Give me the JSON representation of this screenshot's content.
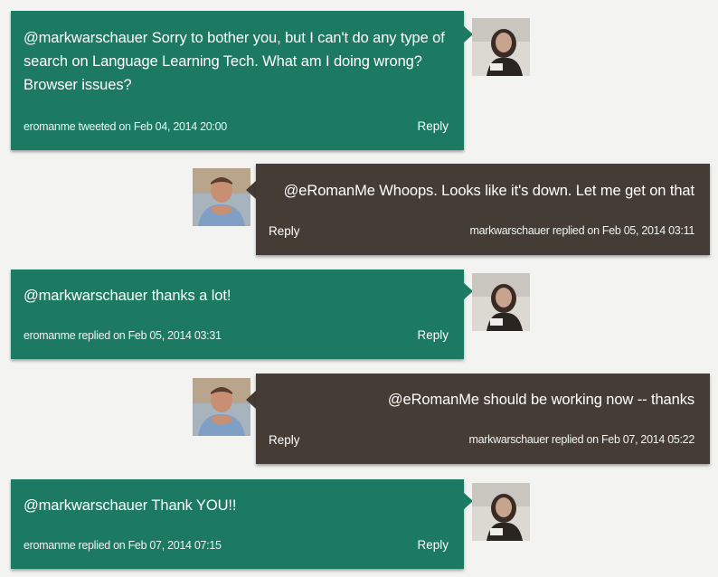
{
  "thread": [
    {
      "author": "eromanme",
      "text": "@markwarschauer Sorry to bother you, but I can't do any type of search on Language Learning Tech. What am I doing wrong? Browser issues?",
      "meta": "eromanme tweeted on Feb 04, 2014 20:00",
      "reply": "Reply"
    },
    {
      "author": "markwarschauer",
      "text": "@eRomanMe Whoops. Looks like it's down. Let me get on that",
      "meta": "markwarschauer replied on Feb 05, 2014 03:11",
      "reply": "Reply"
    },
    {
      "author": "eromanme",
      "text": "@markwarschauer thanks a lot!",
      "meta": "eromanme replied on Feb 05, 2014 03:31",
      "reply": "Reply"
    },
    {
      "author": "markwarschauer",
      "text": "@eRomanMe should be working now -- thanks",
      "meta": "markwarschauer replied on Feb 07, 2014 05:22",
      "reply": "Reply"
    },
    {
      "author": "eromanme",
      "text": "@markwarschauer Thank YOU!!",
      "meta": "eromanme replied on Feb 07, 2014 07:15",
      "reply": "Reply"
    }
  ],
  "colors": {
    "green_bubble": "#1c7a62",
    "brown_bubble": "#463c36",
    "page_background": "#f3f3f1"
  }
}
